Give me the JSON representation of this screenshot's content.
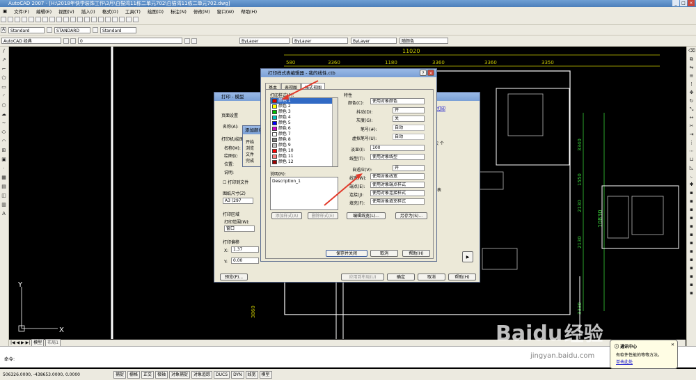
{
  "window": {
    "title": "AutoCAD 2007 - [H:\\2018年快学装饰工作\\3月\\白猫湾11栋二单元702\\白猫湾11栋二单元702.dwg]"
  },
  "menu": [
    "文件(F)",
    "编辑(E)",
    "视图(V)",
    "插入(I)",
    "格式(O)",
    "工具(T)",
    "绘图(D)",
    "标注(N)",
    "修改(M)",
    "窗口(W)",
    "帮助(H)"
  ],
  "toolbar2": {
    "text_style": "Standard",
    "dim_style": "STANDARD",
    "table_style": "Standard"
  },
  "toolbar3": {
    "workspace": "AutoCAD 经典",
    "layer": "0",
    "color": "ByLayer",
    "linetype": "ByLayer",
    "lineweight": "ByLayer",
    "plotstyle": "随颜色"
  },
  "dims": {
    "top_total": "11020",
    "d1": "580",
    "d2": "3360",
    "d3": "1180",
    "d4": "3360",
    "d5": "3360",
    "d6": "3350",
    "r1": "3340",
    "r2": "1550",
    "r3": "2130",
    "r4": "2130",
    "r5": "3330",
    "r_total": "10830",
    "l1": "3860"
  },
  "plot_dialog": {
    "title": "打印 - 模型",
    "page_setup": "页面设置",
    "name_label": "名称(A):",
    "printer_label": "打印机/绘图仪",
    "name2_label": "名称(M):",
    "plotter_label": "绘图仪:",
    "location_label": "位置:",
    "desc_label": "说明:",
    "plot_to_file": "打印到文件",
    "paper_size_label": "图纸尺寸(Z)",
    "paper_size": "A3 (297",
    "plot_area_label": "打印区域",
    "plot_range_label": "打印范围(W):",
    "plot_range": "窗口",
    "offset_label": "打印偏移",
    "x_label": "X:",
    "x_val": "1.37",
    "y_label": "Y:",
    "y_val": "0.00",
    "preview": "预览(P)...",
    "apply_layout": "应用到布局(U)",
    "ok": "确定",
    "cancel": "取消",
    "help": "帮助(H)",
    "help_link": "打印",
    "partial_right": "次 个",
    "partial_right2": "表"
  },
  "add_dialog": {
    "title": "添加颜色...",
    "l1": "开始",
    "l2": "浏览",
    "l3": "文件",
    "l4": "完成"
  },
  "editor": {
    "title": "打印样式表编辑器 - 我的线性.ctb",
    "tabs": [
      "基本",
      "表视图",
      "格式视图"
    ],
    "active_tab": 2,
    "styles_label": "打印样式(P):",
    "styles": [
      {
        "name": "颜色 1",
        "color": "#e00000"
      },
      {
        "name": "颜色 2",
        "color": "#ffff00"
      },
      {
        "name": "颜色 3",
        "color": "#00c000"
      },
      {
        "name": "颜色 4",
        "color": "#00c0c0"
      },
      {
        "name": "颜色 5",
        "color": "#0000ff"
      },
      {
        "name": "颜色 6",
        "color": "#d000d0"
      },
      {
        "name": "颜色 7",
        "color": "#ffffff"
      },
      {
        "name": "颜色 8",
        "color": "#808080"
      },
      {
        "name": "颜色 9",
        "color": "#c0c0c0"
      },
      {
        "name": "颜色 10",
        "color": "#ff0000"
      },
      {
        "name": "颜色 11",
        "color": "#ff8080"
      },
      {
        "name": "颜色 12",
        "color": "#a00000"
      }
    ],
    "desc_label": "说明(R):",
    "desc_value": "Description_1",
    "add_style": "添加样式(A)",
    "del_style": "删除样式(E)",
    "props_label": "特性",
    "color_label": "颜色(C):",
    "color_value": "使用对象颜色",
    "dither_label": "抖动(D):",
    "dither_value": "开",
    "gray_label": "灰度(G):",
    "gray_value": "关",
    "pen_label": "笔号(#):",
    "pen_value": "自动",
    "vpen_label": "虚拟笔号(U):",
    "vpen_value": "自动",
    "screen_label": "淡显(I):",
    "screen_value": "100",
    "linetype_label": "线型(T):",
    "linetype_value": "使用对象线型",
    "adaptive_label": "自适应(V):",
    "adaptive_value": "开",
    "lineweight_label": "线宽(W):",
    "lineweight_value": "使用对象线宽",
    "endstyle_label": "端点(E):",
    "endstyle_value": "使用对象端点样式",
    "joinstyle_label": "连接(J):",
    "joinstyle_value": "使用对象连接样式",
    "fill_label": "填充(F):",
    "fill_value": "使用对象填充样式",
    "edit_lineweights": "编辑线宽(L)...",
    "save_as": "另存为(S)...",
    "save_close": "保存并关闭",
    "cancel": "取消",
    "help": "帮助(H)"
  },
  "bottom": {
    "tab_model": "模型",
    "tab_layout": "布局1"
  },
  "cmd": {
    "prompt": "命令:"
  },
  "status": {
    "coords": "506326.0000, -438653.0000, 0.0000",
    "toggles": [
      "捕捉",
      "栅格",
      "正交",
      "极轴",
      "对象捕捉",
      "对象追踪",
      "DUCS",
      "DYN",
      "线宽",
      "模型"
    ]
  },
  "notify": {
    "title": "通讯中心",
    "text": "有软件性能的等等方法。",
    "link": "单击此处"
  },
  "watermark": {
    "brand": "Baidu",
    "text": "经验",
    "url": "jingyan.baidu.com"
  },
  "colors": {
    "dim": "#c8c800",
    "dim_green": "#38d038",
    "wall": "#ffffff",
    "arrow": "#e23a2a"
  }
}
